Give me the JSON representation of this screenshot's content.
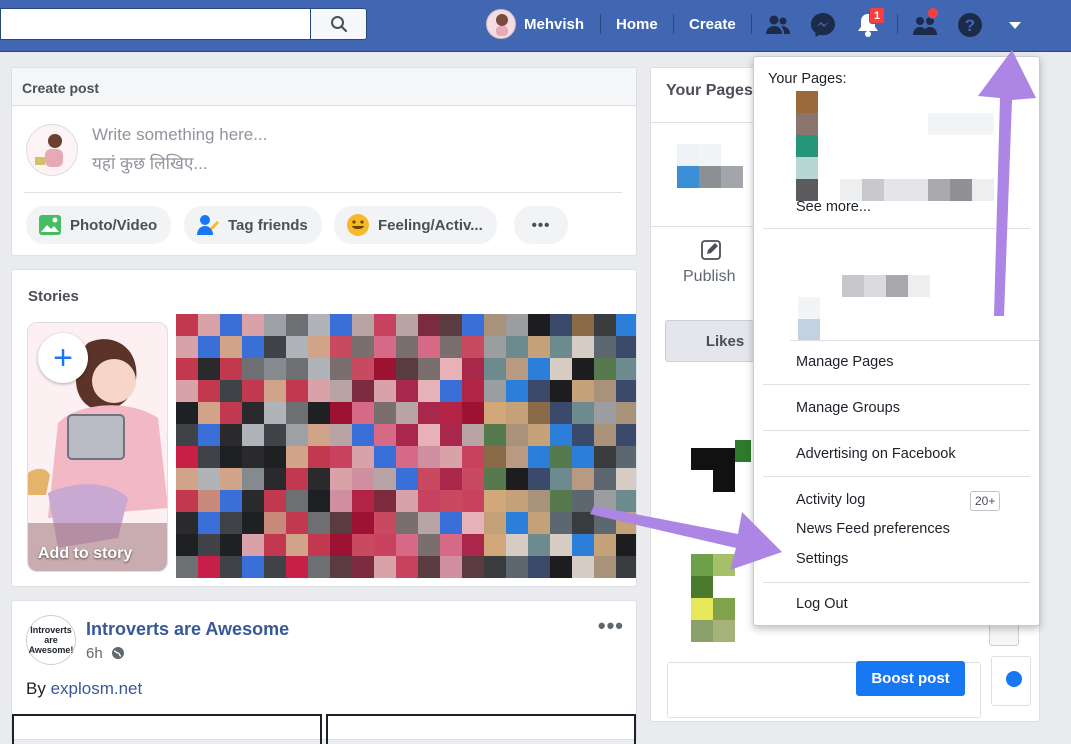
{
  "topbar": {
    "search_placeholder": "",
    "user_name": "Mehvish",
    "home_label": "Home",
    "create_label": "Create",
    "notification_count": "1",
    "icons": [
      "search-icon",
      "friends-icon",
      "messenger-icon",
      "bell-icon",
      "groups-icon",
      "help-icon",
      "caret-down-icon"
    ]
  },
  "composer": {
    "header": "Create post",
    "placeholder_en": "Write something here...",
    "placeholder_hi": "यहां कुछ लिखिए...",
    "actions": [
      "Photo/Video",
      "Tag friends",
      "Feeling/Activ..."
    ],
    "more": "•••"
  },
  "stories": {
    "title": "Stories",
    "add_label": "Add to story"
  },
  "post": {
    "page_name": "Introverts are Awesome",
    "time": "6h",
    "text_prefix": "By ",
    "link": "explosm.net",
    "avatar_text": "Introverts are Awesome!",
    "more": "•••"
  },
  "pages_card": {
    "title": "Your Pages",
    "publish_label": "Publish",
    "likes_label": "Likes",
    "boost_label": "Boost post"
  },
  "dropdown": {
    "your_pages_label": "Your Pages:",
    "see_more": "See more...",
    "manage_pages": "Manage Pages",
    "manage_groups": "Manage Groups",
    "advertising": "Advertising on Facebook",
    "activity_log": "Activity log",
    "activity_badge": "20+",
    "news_feed_prefs": "News Feed preferences",
    "settings": "Settings",
    "log_out": "Log Out"
  },
  "colors": {
    "brand": "#4267b2",
    "link": "#385898",
    "accent_blue": "#1877f2",
    "arrow": "#a78bdf"
  }
}
